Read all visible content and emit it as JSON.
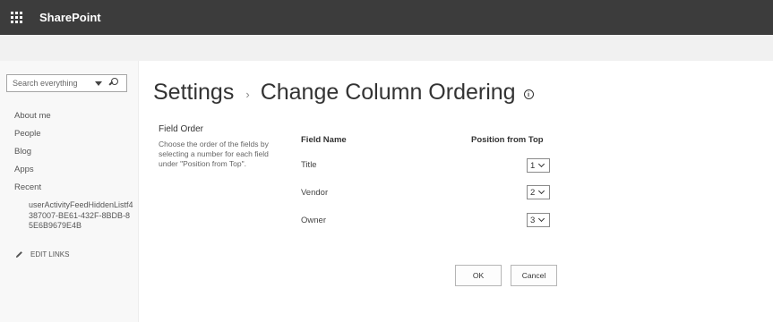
{
  "suitebar": {
    "app_name": "SharePoint",
    "bg_color": "#3c3c3c"
  },
  "search": {
    "placeholder": "Search everything"
  },
  "nav": {
    "items": [
      "About me",
      "People",
      "Blog",
      "Apps",
      "Recent"
    ],
    "recent_item": "userActivityFeedHiddenListf4387007-BE61-432F-8BDB-85E6B9679E4B",
    "edit_links": "EDIT LINKS"
  },
  "page": {
    "title_root": "Settings",
    "title_separator": "›",
    "title_page": "Change Column Ordering",
    "info_glyph": "i"
  },
  "field_order": {
    "title": "Field Order",
    "description": "Choose the order of the fields by selecting a number for each field under \"Position from Top\"."
  },
  "table": {
    "headers": {
      "field_name": "Field Name",
      "position": "Position from Top"
    },
    "rows": [
      {
        "name": "Title",
        "position": "1"
      },
      {
        "name": "Vendor",
        "position": "2"
      },
      {
        "name": "Owner",
        "position": "3"
      }
    ]
  },
  "buttons": {
    "ok": "OK",
    "cancel": "Cancel"
  }
}
